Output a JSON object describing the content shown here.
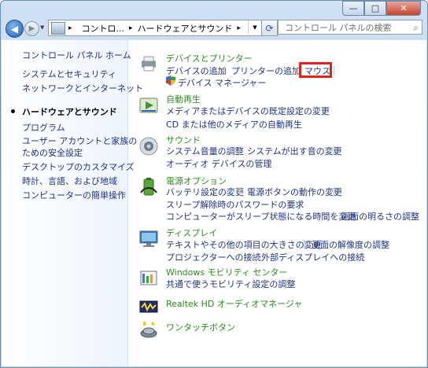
{
  "window": {
    "controls": [
      "—",
      "□",
      "✕"
    ]
  },
  "nav": {
    "address": [
      "コントロ...",
      "ハードウェアとサウンド"
    ],
    "search_placeholder": "コントロール パネルの検索"
  },
  "sidebar": {
    "items": [
      "コントロール パネル ホーム",
      "システムとセキュリティ",
      "ネットワークとインターネット",
      "ハードウェアとサウンド",
      "プログラム",
      "ユーザー アカウントと家族の",
      "ための安全設定",
      "デスクトップのカスタマイズ",
      "時計、言語、および地域",
      "コンピューターの簡単操作"
    ]
  },
  "categories": {
    "devices": {
      "title": "デバイスとプリンター",
      "links": [
        "デバイスの追加",
        "プリンターの追加",
        "マウス",
        "デバイス マネージャー"
      ]
    },
    "autoplay": {
      "title": "自動再生",
      "links": [
        "メディアまたはデバイスの既定設定の変更",
        "CD または他のメディアの自動再生"
      ]
    },
    "sound": {
      "title": "サウンド",
      "links": [
        "システム音量の調整",
        "システムが出す音の変更",
        "オーディオ デバイスの管理"
      ]
    },
    "power": {
      "title": "電源オプション",
      "links": [
        "バッテリ設定の変更",
        "電源ボタンの動作の変更",
        "スリープ解除時のパスワードの要求",
        "コンピューターがスリープ状態になる時間を変更",
        "画面の明るさの調整"
      ]
    },
    "display": {
      "title": "ディスプレイ",
      "links": [
        "テキストやその他の項目の大きさの変更",
        "画面の解像度の調整",
        "プロジェクターへの接続",
        "外部ディスプレイへの接続"
      ]
    },
    "mobility": {
      "title": "Windows モビリティ センター",
      "links": [
        "共通で使うモビリティ設定の調整"
      ]
    },
    "realtek": {
      "title": "Realtek HD オーディオマネージャ"
    },
    "onetouch": {
      "title": "ワンタッチボタン"
    }
  },
  "colors": {
    "link": "#1e3287",
    "category_title": "#2b8c1e",
    "highlight": "#e0241b"
  }
}
